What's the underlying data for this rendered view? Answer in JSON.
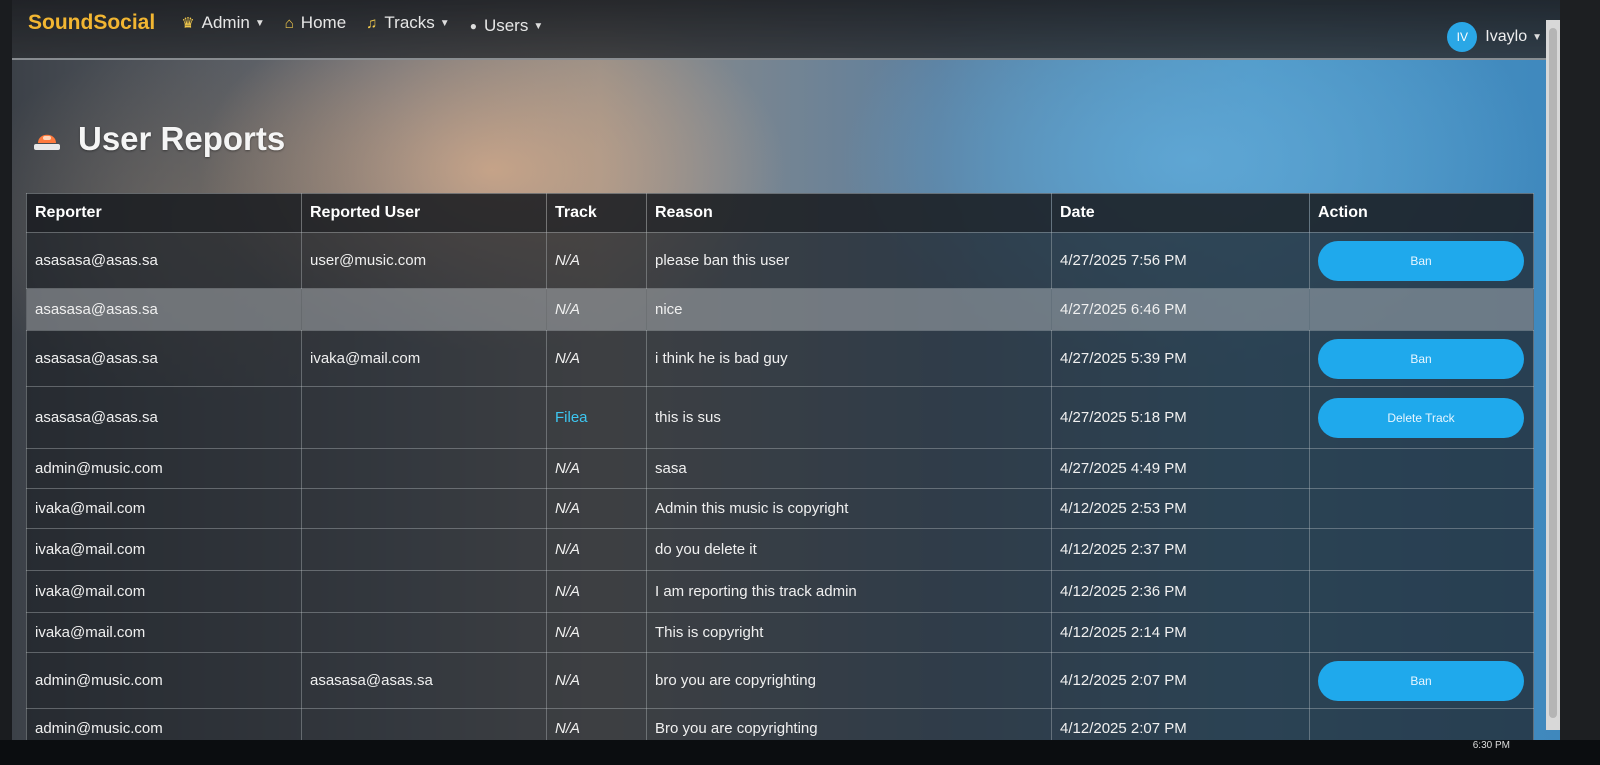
{
  "navbar": {
    "brand": "SoundSocial",
    "items": [
      {
        "label": "Admin",
        "icon": "crown-icon",
        "dropdown": true
      },
      {
        "label": "Home",
        "icon": "home-icon",
        "dropdown": false
      },
      {
        "label": "Tracks",
        "icon": "music-note-icon",
        "dropdown": true
      },
      {
        "label": "Users",
        "icon": "user-icon",
        "dropdown": true
      }
    ],
    "user": {
      "initials": "IV",
      "name": "Ivaylo"
    }
  },
  "page": {
    "title": "User Reports",
    "title_icon": "siren-icon"
  },
  "table": {
    "headers": [
      "Reporter",
      "Reported User",
      "Track",
      "Reason",
      "Date",
      "Action"
    ],
    "rows": [
      {
        "reporter": "asasasa@asas.sa",
        "reported_user": "user@music.com",
        "track": "N/A",
        "reason": "please ban this user",
        "date": "4/27/2025 7:56 PM",
        "action": "Ban"
      },
      {
        "reporter": "asasasa@asas.sa",
        "reported_user": "",
        "track": "N/A",
        "reason": "nice",
        "date": "4/27/2025 6:46 PM",
        "action": ""
      },
      {
        "reporter": "asasasa@asas.sa",
        "reported_user": "ivaka@mail.com",
        "track": "N/A",
        "reason": "i think he is bad guy",
        "date": "4/27/2025 5:39 PM",
        "action": "Ban"
      },
      {
        "reporter": "asasasa@asas.sa",
        "reported_user": "",
        "track": "Filea",
        "reason": "this is sus",
        "date": "4/27/2025 5:18 PM",
        "action": "Delete Track"
      },
      {
        "reporter": "admin@music.com",
        "reported_user": "",
        "track": "N/A",
        "reason": "sasa",
        "date": "4/27/2025 4:49 PM",
        "action": ""
      },
      {
        "reporter": "ivaka@mail.com",
        "reported_user": "",
        "track": "N/A",
        "reason": "Admin this music is copyright",
        "date": "4/12/2025 2:53 PM",
        "action": ""
      },
      {
        "reporter": "ivaka@mail.com",
        "reported_user": "",
        "track": "N/A",
        "reason": "do you delete it",
        "date": "4/12/2025 2:37 PM",
        "action": ""
      },
      {
        "reporter": "ivaka@mail.com",
        "reported_user": "",
        "track": "N/A",
        "reason": "I am reporting this track admin",
        "date": "4/12/2025 2:36 PM",
        "action": ""
      },
      {
        "reporter": "ivaka@mail.com",
        "reported_user": "",
        "track": "N/A",
        "reason": "This is copyright",
        "date": "4/12/2025 2:14 PM",
        "action": ""
      },
      {
        "reporter": "admin@music.com",
        "reported_user": "asasasa@asas.sa",
        "track": "N/A",
        "reason": "bro you are copyrighting",
        "date": "4/12/2025 2:07 PM",
        "action": "Ban"
      },
      {
        "reporter": "admin@music.com",
        "reported_user": "",
        "track": "N/A",
        "reason": "Bro you are copyrighting",
        "date": "4/12/2025 2:07 PM",
        "action": ""
      }
    ]
  },
  "taskbar": {
    "time": "6:30 PM"
  },
  "colors": {
    "brand": "#f2b632",
    "button": "#1fa9ec",
    "link": "#3dc6f0",
    "avatar": "#2aa7e6"
  }
}
